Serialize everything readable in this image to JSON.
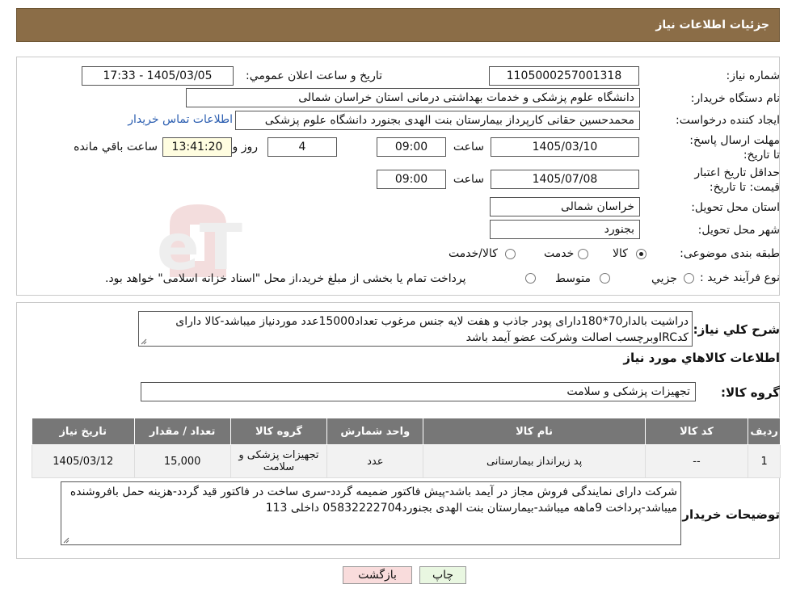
{
  "header": {
    "title": "جزئیات اطلاعات نیاز"
  },
  "fields": {
    "need_number_label": "شماره نیاز:",
    "need_number": "1105000257001318",
    "announce_label": "تاریخ و ساعت اعلان عمومي:",
    "announce_value": "1405/03/05 - 17:33",
    "buyer_org_label": "نام دستگاه خريدار:",
    "buyer_org": "دانشگاه علوم پزشکی و خدمات بهداشتی درمانی استان خراسان شمالی",
    "creator_label": "ايجاد کننده درخواست:",
    "creator": "محمدحسین حقانی کارپرداز بیمارستان بنت الهدی بجنورد دانشگاه علوم پزشکی",
    "contact_link": "اطلاعات تماس خريدار",
    "reply_deadline_label": "مهلت ارسال پاسخ: تا تاريخ:",
    "reply_date": "1405/03/10",
    "time_label": "ساعت",
    "reply_time": "09:00",
    "days_value": "4",
    "days_label": "روز و",
    "remaining_time": "13:41:20",
    "remaining_label": "ساعت باقي مانده",
    "price_validity_label": "حداقل تاريخ اعتبار قيمت: تا تاريخ:",
    "validity_date": "1405/07/08",
    "validity_time": "09:00",
    "province_label": "استان محل تحويل:",
    "province": "خراسان شمالی",
    "city_label": "شهر محل تحويل:",
    "city": "بجنورد",
    "category_label": "طبقه بندی موضوعی:",
    "category_options": [
      "کالا",
      "خدمت",
      "کالا/خدمت"
    ],
    "purchase_type_label": "نوع فرآيند خريد :",
    "purchase_options": [
      "جزيي",
      "متوسط"
    ],
    "purchase_note": "پرداخت تمام یا بخشی از مبلغ خرید،از محل \"اسناد خزانه اسلامی\" خواهد بود."
  },
  "description": {
    "label": "شرح کلي نياز:",
    "text": "دراشیت بالدار70*180دارای پودر جاذب و هفت لایه جنس مرغوب تعداد15000عدد موردنیاز میباشد-کالا دارای کدIRCوبرچسب اصالت وشرکت عضو آیمد باشد"
  },
  "goods": {
    "section_title": "اطلاعات کالاهاي مورد نياز",
    "group_label": "گروه کالا:",
    "group_value": "تجهیزات پزشکی و سلامت",
    "columns": [
      "رديف",
      "کد کالا",
      "نام کالا",
      "واحد شمارش",
      "گروه کالا",
      "تعداد / مقدار",
      "تاریخ نیاز"
    ],
    "rows": [
      [
        "1",
        "--",
        "پد زیرانداز بیمارستانی",
        "عدد",
        "تجهیزات پزشکی و سلامت",
        "15,000",
        "1405/03/12"
      ]
    ]
  },
  "buyer_notes": {
    "label": "توضيحات خريدار:",
    "text": "شرکت دارای نمایندگی فروش مجاز در آیمد باشد-پیش فاکتور ضمیمه گردد-سری ساخت در فاکتور قید گردد-هزینه حمل بافروشنده میباشد-پرداخت 9ماهه میباشد-بیمارستان بنت الهدی بجنورد05832222704 داخلی 113"
  },
  "buttons": {
    "print": "چاپ",
    "back": "بازگشت"
  },
  "watermark": {
    "text": "AriaTender.neT"
  },
  "colors": {
    "header_bg": "#8b6d47",
    "table_header": "#777777",
    "print_btn": "#e9f7e1",
    "back_btn": "#f9dcdc"
  }
}
